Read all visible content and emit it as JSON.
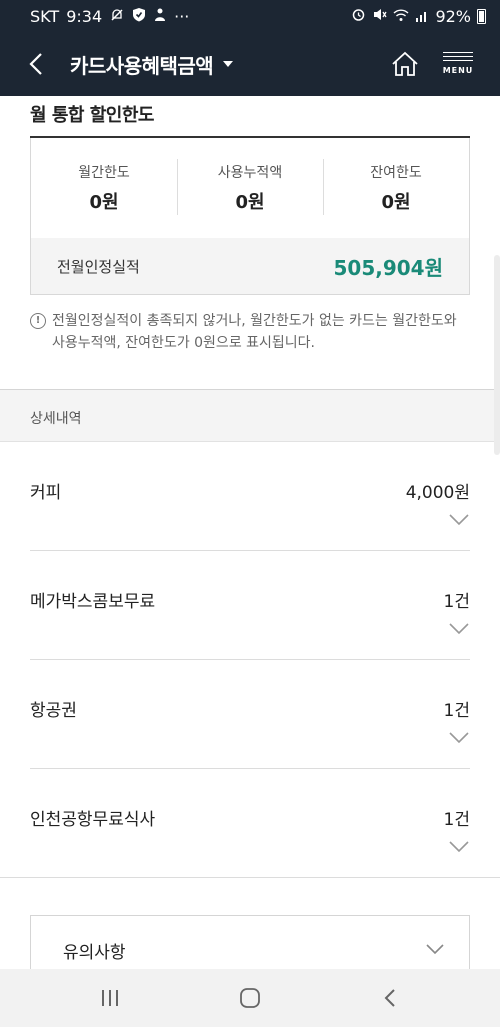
{
  "status_bar": {
    "carrier": "SKT",
    "time": "9:34",
    "more": "···",
    "battery": "92%"
  },
  "header": {
    "back_icon": "back-arrow-icon",
    "title": "카드사용혜택금액",
    "home_icon": "home-icon",
    "menu_label": "MENU"
  },
  "limits": {
    "section_title": "월 통합 할인한도",
    "columns": [
      {
        "label": "월간한도",
        "value": "0원"
      },
      {
        "label": "사용누적액",
        "value": "0원"
      },
      {
        "label": "잔여한도",
        "value": "0원"
      }
    ],
    "performance": {
      "label": "전월인정실적",
      "value": "505,904원"
    },
    "accent_color": "#1a8a78"
  },
  "notice": {
    "icon": "exclamation-circle-icon",
    "text": "전월인정실적이 총족되지 않거나, 월간한도가 없는 카드는 월간한도와 사용누적액, 잔여한도가 0원으로 표시됩니다."
  },
  "details": {
    "title": "상세내역",
    "items": [
      {
        "name": "커피",
        "value": "4,000원"
      },
      {
        "name": "메가박스콤보무료",
        "value": "1건"
      },
      {
        "name": "항공권",
        "value": "1건"
      },
      {
        "name": "인천공항무료식사",
        "value": "1건"
      }
    ]
  },
  "caution": {
    "label": "유의사항"
  },
  "nav_bar": {
    "icons": [
      "recent-apps-icon",
      "home-circle-icon",
      "back-chevron-icon"
    ]
  },
  "colors": {
    "header_bg": "#1c2633"
  }
}
